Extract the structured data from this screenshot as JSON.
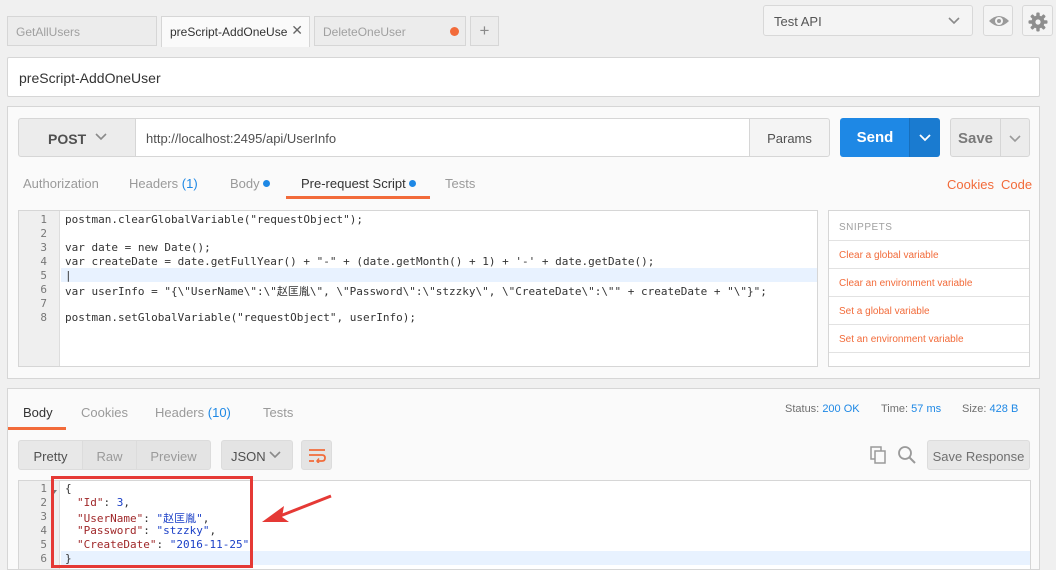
{
  "tabs": [
    {
      "label": "GetAllUsers",
      "state": "inactive"
    },
    {
      "label": "preScript-AddOneUse",
      "state": "active"
    },
    {
      "label": "DeleteOneUser",
      "state": "unsaved"
    }
  ],
  "new_tab_label": "+",
  "environment": {
    "selected": "Test API"
  },
  "request": {
    "name": "preScript-AddOneUser",
    "method": "POST",
    "url": "http://localhost:2495/api/UserInfo",
    "params_label": "Params",
    "send_label": "Send",
    "save_label": "Save"
  },
  "request_tabs": {
    "authorization": "Authorization",
    "headers": "Headers",
    "headers_count": "(1)",
    "body": "Body",
    "prerequest": "Pre-request Script",
    "tests": "Tests",
    "cookies": "Cookies",
    "code": "Code"
  },
  "script": {
    "line_numbers": [
      "1",
      "2",
      "3",
      "4",
      "5",
      "6",
      "7",
      "8"
    ],
    "lines": [
      "postman.clearGlobalVariable(\"requestObject\");",
      "",
      "var date = new Date();",
      "var createDate = date.getFullYear() + \"-\" + (date.getMonth() + 1) + '-' + date.getDate();",
      "",
      "var userInfo = \"{\\\"UserName\\\":\\\"赵匡胤\\\", \\\"Password\\\":\\\"stzzky\\\", \\\"CreateDate\\\":\\\"\" + createDate + \"\\\"}\";",
      "",
      "postman.setGlobalVariable(\"requestObject\", userInfo);"
    ]
  },
  "snippets": {
    "heading": "SNIPPETS",
    "items": [
      "Clear a global variable",
      "Clear an environment variable",
      "Set a global variable",
      "Set an environment variable"
    ]
  },
  "response_tabs": {
    "body": "Body",
    "cookies": "Cookies",
    "headers": "Headers",
    "headers_count": "(10)",
    "tests": "Tests"
  },
  "response_status": {
    "status_label": "Status:",
    "status_value": "200 OK",
    "time_label": "Time:",
    "time_value": "57 ms",
    "size_label": "Size:",
    "size_value": "428 B"
  },
  "view_modes": [
    "Pretty",
    "Raw",
    "Preview"
  ],
  "format_selected": "JSON",
  "save_response_label": "Save Response",
  "response_body": {
    "line_numbers": [
      "1",
      "2",
      "3",
      "4",
      "5",
      "6"
    ],
    "open": "{",
    "id_key": "\"Id\"",
    "id_value": "3",
    "username_key": "\"UserName\"",
    "username_value": "\"赵匡胤\"",
    "password_key": "\"Password\"",
    "password_value": "\"stzzky\"",
    "createdate_key": "\"CreateDate\"",
    "createdate_value": "\"2016-11-25\"",
    "close": "}"
  },
  "colors": {
    "accent_blue": "#1e88e5",
    "accent_orange": "#f26b3a",
    "annotation_red": "#e53935"
  }
}
